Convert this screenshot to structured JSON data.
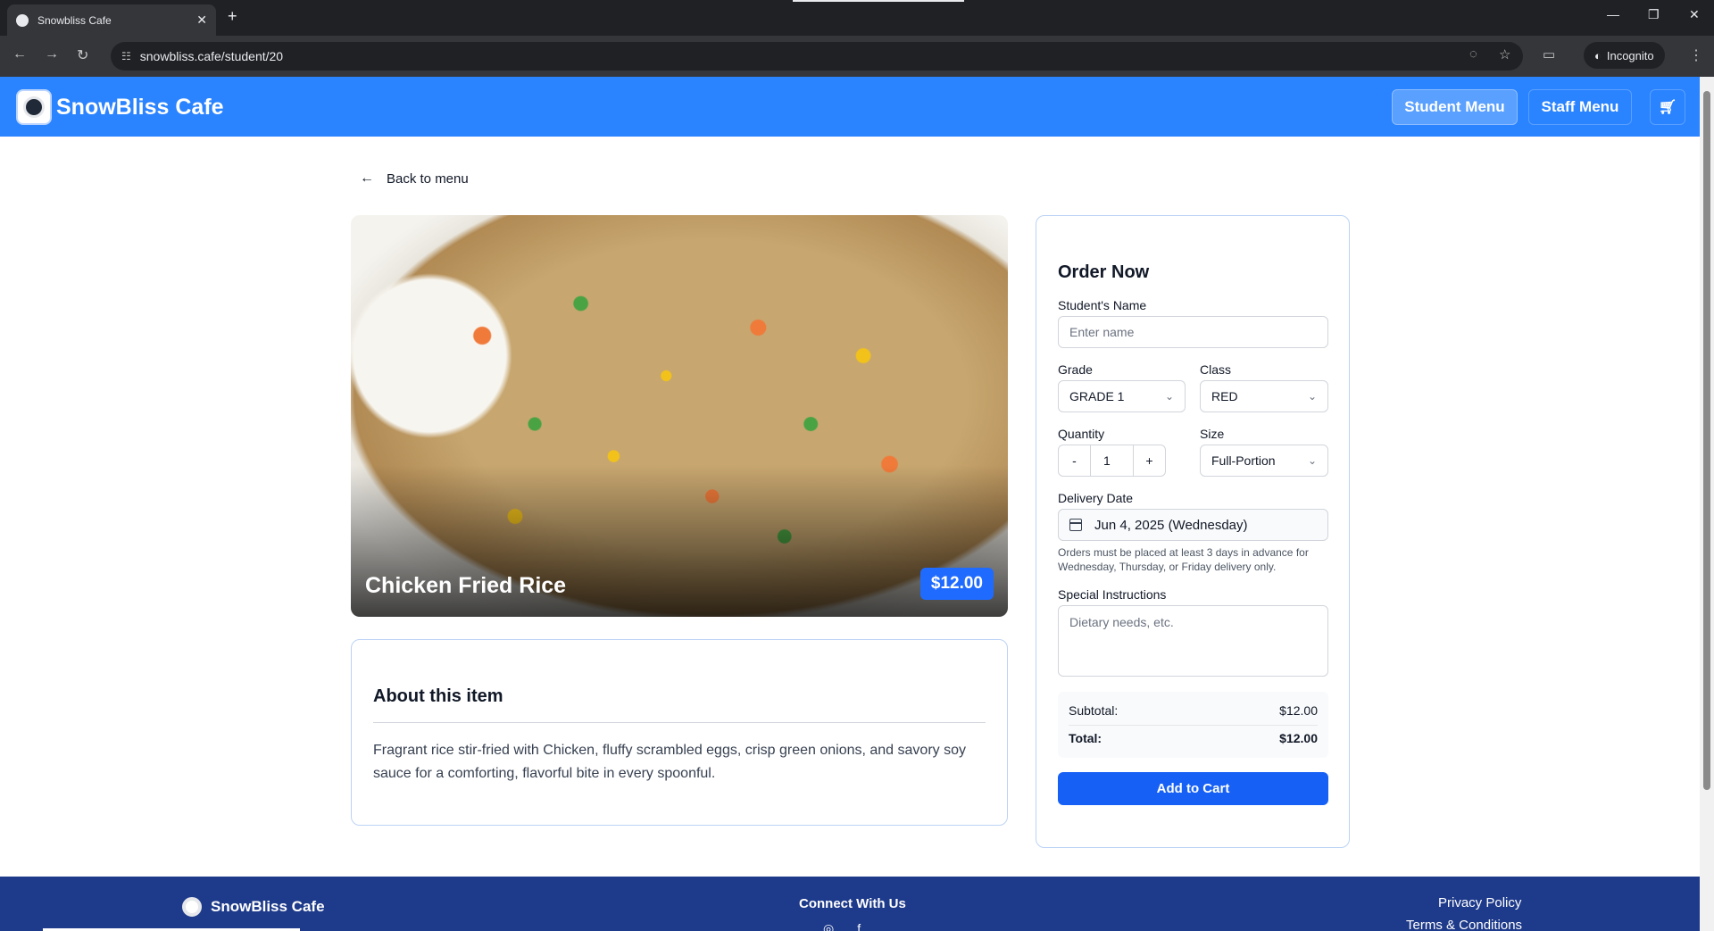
{
  "browser": {
    "tab_title": "Snowbliss Cafe",
    "url": "snowbliss.cafe/student/20",
    "incognito_label": "Incognito"
  },
  "header": {
    "brand": "SnowBliss Cafe",
    "nav": {
      "student": "Student Menu",
      "staff": "Staff Menu"
    },
    "accent": "#2a83ff"
  },
  "back_link": "Back to menu",
  "item": {
    "name": "Chicken Fried Rice",
    "price": "$12.00",
    "about_title": "About this item",
    "description": "Fragrant rice stir-fried with Chicken, fluffy scrambled eggs, crisp green onions, and savory soy sauce for a comforting, flavorful bite in every spoonful."
  },
  "order": {
    "title": "Order Now",
    "student_name": {
      "label": "Student's Name",
      "placeholder": "Enter name"
    },
    "grade": {
      "label": "Grade",
      "value": "GRADE 1"
    },
    "class": {
      "label": "Class",
      "value": "RED"
    },
    "quantity": {
      "label": "Quantity",
      "minus": "-",
      "value": "1",
      "plus": "+"
    },
    "size": {
      "label": "Size",
      "value": "Full-Portion"
    },
    "delivery": {
      "label": "Delivery Date",
      "value": "Jun 4, 2025 (Wednesday)",
      "note": "Orders must be placed at least 3 days in advance for Wednesday, Thursday, or Friday delivery only."
    },
    "instructions": {
      "label": "Special Instructions",
      "placeholder": "Dietary needs, etc."
    },
    "subtotal_label": "Subtotal:",
    "subtotal": "$12.00",
    "total_label": "Total:",
    "total": "$12.00",
    "add_button": "Add to Cart"
  },
  "footer": {
    "brand": "SnowBliss Cafe",
    "connect": "Connect With Us",
    "privacy": "Privacy Policy",
    "terms": "Terms & Conditions"
  }
}
